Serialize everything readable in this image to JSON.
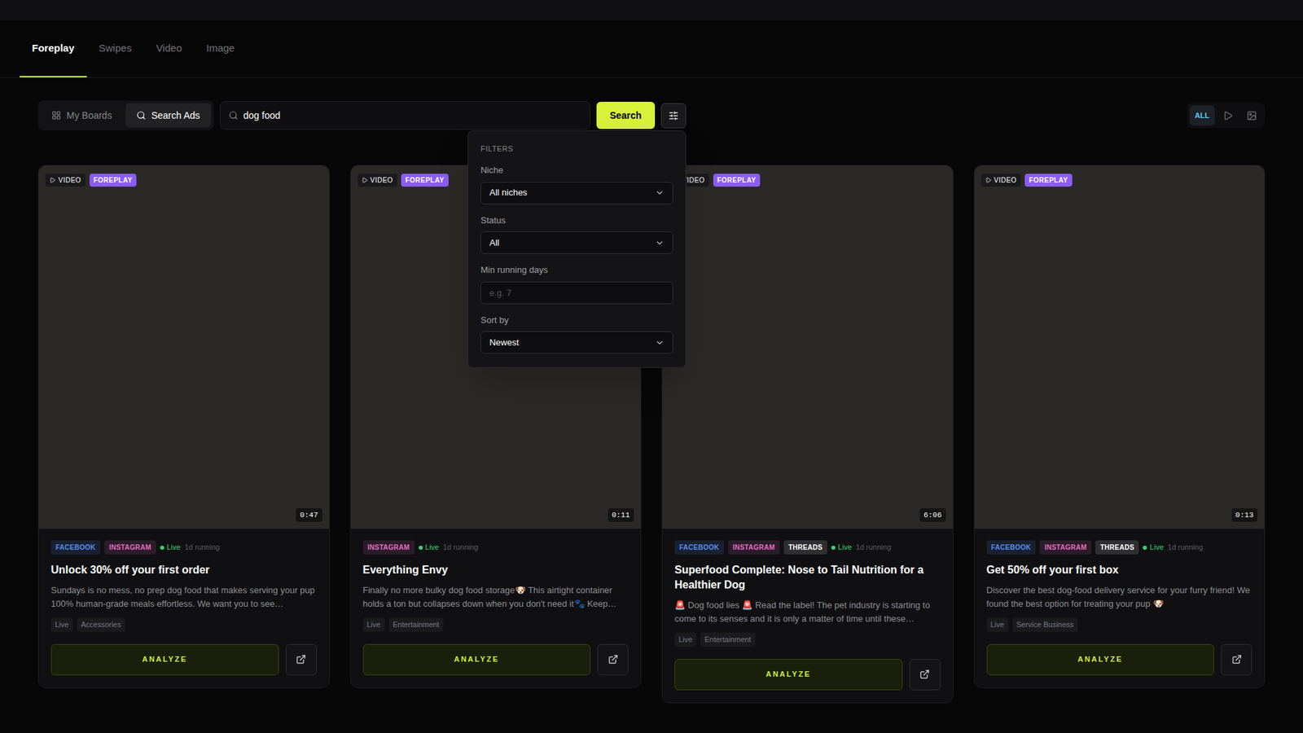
{
  "tabs": [
    {
      "label": "Foreplay",
      "selected": true
    },
    {
      "label": "Swipes",
      "selected": false
    },
    {
      "label": "Video",
      "selected": false
    },
    {
      "label": "Image",
      "selected": false
    }
  ],
  "toolbar": {
    "modes": [
      {
        "label": "My Boards",
        "kind": "boards",
        "selected": false
      },
      {
        "label": "Search Ads",
        "kind": "search",
        "selected": true
      }
    ],
    "search": {
      "value": "dog food"
    },
    "search_button": "Search",
    "filter_open": true,
    "view_types": [
      {
        "kind": "all",
        "label": "ALL",
        "selected": true
      },
      {
        "kind": "video",
        "selected": false
      },
      {
        "kind": "image",
        "selected": false
      }
    ]
  },
  "filters": {
    "title": "FILTERS",
    "fields": [
      {
        "label": "Niche",
        "kind": "select",
        "value": "All niches"
      },
      {
        "label": "Status",
        "kind": "select",
        "value": "All"
      },
      {
        "label": "Min running days",
        "kind": "input",
        "placeholder": "e.g. 7"
      },
      {
        "label": "Sort by",
        "kind": "select",
        "value": "Newest"
      }
    ]
  },
  "cards": [
    {
      "type": "VIDEO",
      "source": "FOREPLAY",
      "duration": "0:47",
      "platforms": [
        {
          "label": "FACEBOOK",
          "color": "#5b8def"
        },
        {
          "label": "INSTAGRAM",
          "color": "#e070c0"
        }
      ],
      "status": "Live",
      "running": "1d running",
      "title": "Unlock 30% off your first order",
      "description": "Sundays is no mess, no prep dog food that makes serving your pup 100% human-grade meals effortless. We want you to see…",
      "tags": [
        "Live",
        "Accessories"
      ],
      "action": "ANALYZE"
    },
    {
      "type": "VIDEO",
      "source": "FOREPLAY",
      "duration": "0:11",
      "platforms": [
        {
          "label": "INSTAGRAM",
          "color": "#e070c0"
        }
      ],
      "status": "Live",
      "running": "1d running",
      "title": "Everything Envy",
      "description": "Finally no more bulky dog food storage🐶 This airtight container holds a ton but collapses down when you don't need it🐾 Keep…",
      "tags": [
        "Live",
        "Entertainment"
      ],
      "action": "ANALYZE"
    },
    {
      "type": "VIDEO",
      "source": "FOREPLAY",
      "duration": "6:06",
      "platforms": [
        {
          "label": "FACEBOOK",
          "color": "#5b8def"
        },
        {
          "label": "INSTAGRAM",
          "color": "#e070c0"
        },
        {
          "label": "THREADS",
          "color": "#ffffff"
        }
      ],
      "status": "Live",
      "running": "1d running",
      "title": "Superfood Complete: Nose to Tail Nutrition for a Healthier Dog",
      "description": "🚨 Dog food lies 🚨 Read the label! The pet industry is starting to come to its senses and it is only a matter of time until these…",
      "tags": [
        "Live",
        "Entertainment"
      ],
      "action": "ANALYZE"
    },
    {
      "type": "VIDEO",
      "source": "FOREPLAY",
      "duration": "0:13",
      "platforms": [
        {
          "label": "FACEBOOK",
          "color": "#5b8def"
        },
        {
          "label": "INSTAGRAM",
          "color": "#e070c0"
        },
        {
          "label": "THREADS",
          "color": "#ffffff"
        }
      ],
      "status": "Live",
      "running": "1d running",
      "title": "Get 50% off your first box",
      "description": "Discover the best dog-food delivery service for your furry friend! We found the best option for treating your pup 🐶",
      "tags": [
        "Live",
        "Service Business"
      ],
      "action": "ANALYZE"
    }
  ]
}
